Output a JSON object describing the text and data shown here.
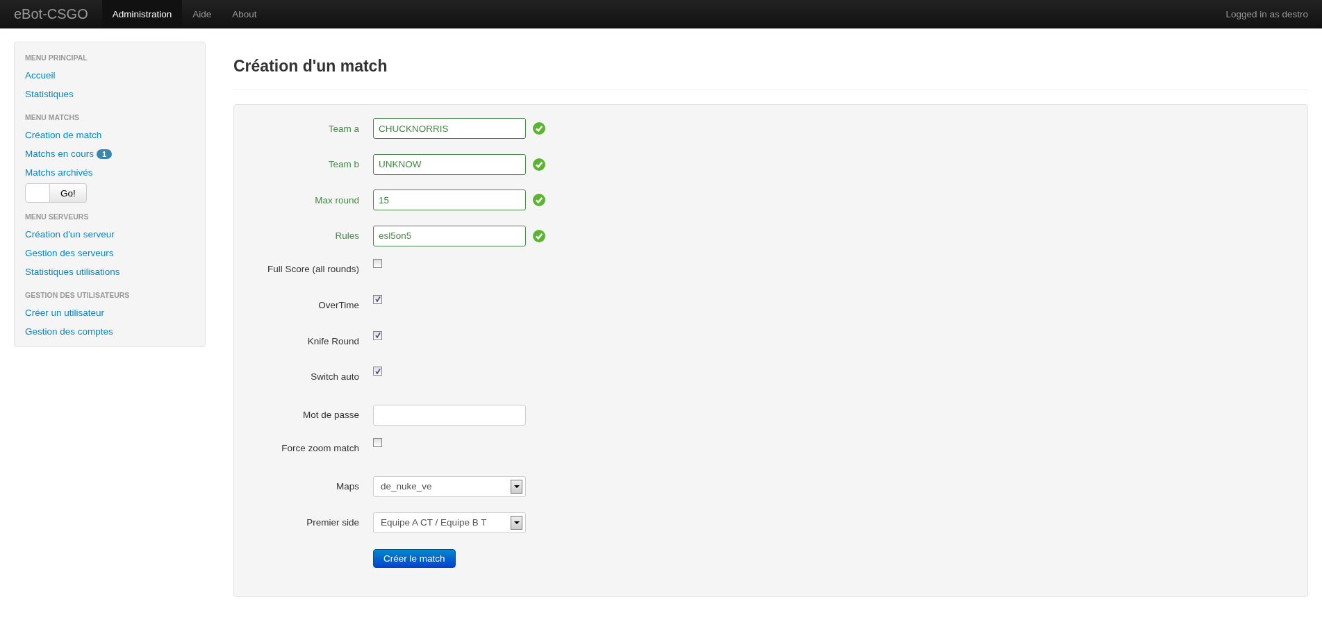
{
  "navbar": {
    "brand": "eBot-CSGO",
    "items": [
      {
        "label": "Administration",
        "selected": true
      },
      {
        "label": "Aide",
        "selected": false
      },
      {
        "label": "About",
        "selected": false
      }
    ],
    "user": "Logged in as destro"
  },
  "sidebar": {
    "sections": [
      {
        "heading": "MENU PRINCIPAL",
        "items": [
          {
            "kind": "link",
            "label": "Accueil"
          },
          {
            "kind": "link",
            "label": "Statistiques"
          }
        ]
      },
      {
        "heading": "MENU MATCHS",
        "items": [
          {
            "kind": "link",
            "label": "Création de match"
          },
          {
            "kind": "link",
            "label": "Matchs en cours",
            "badge": "1"
          },
          {
            "kind": "link",
            "label": "Matchs archivés"
          },
          {
            "kind": "go",
            "button": "Go!"
          }
        ]
      },
      {
        "heading": "MENU SERVEURS",
        "items": [
          {
            "kind": "link",
            "label": "Création d'un serveur"
          },
          {
            "kind": "link",
            "label": "Gestion des serveurs"
          },
          {
            "kind": "link",
            "label": "Statistiques utilisations"
          }
        ]
      },
      {
        "heading": "GESTION DES UTILISATEURS",
        "items": [
          {
            "kind": "link",
            "label": "Créer un utilisateur"
          },
          {
            "kind": "link",
            "label": "Gestion des comptes"
          }
        ]
      }
    ]
  },
  "page": {
    "title": "Création d'un match"
  },
  "form": {
    "fields": [
      {
        "kind": "text",
        "label": "Team a",
        "value": "CHUCKNORRIS",
        "valid": true
      },
      {
        "kind": "text",
        "label": "Team b",
        "value": "UNKNOW",
        "valid": true
      },
      {
        "kind": "text",
        "label": "Max round",
        "value": "15",
        "valid": true
      },
      {
        "kind": "text",
        "label": "Rules",
        "value": "esl5on5",
        "valid": true
      },
      {
        "kind": "checkbox",
        "label": "Full Score (all rounds)",
        "checked": false
      },
      {
        "kind": "checkbox",
        "label": "OverTime",
        "checked": true
      },
      {
        "kind": "checkbox",
        "label": "Knife Round",
        "checked": true
      },
      {
        "kind": "checkbox",
        "label": "Switch auto",
        "checked": true
      },
      {
        "kind": "text",
        "label": "Mot de passe",
        "valid": false
      },
      {
        "kind": "checkbox",
        "label": "Force zoom match",
        "checked": false
      },
      {
        "kind": "select",
        "label": "Maps",
        "value": "de_nuke_ve"
      },
      {
        "kind": "select",
        "label": "Premier side",
        "value": "Equipe A CT / Equipe B T"
      }
    ],
    "submit": "Créer le match"
  }
}
